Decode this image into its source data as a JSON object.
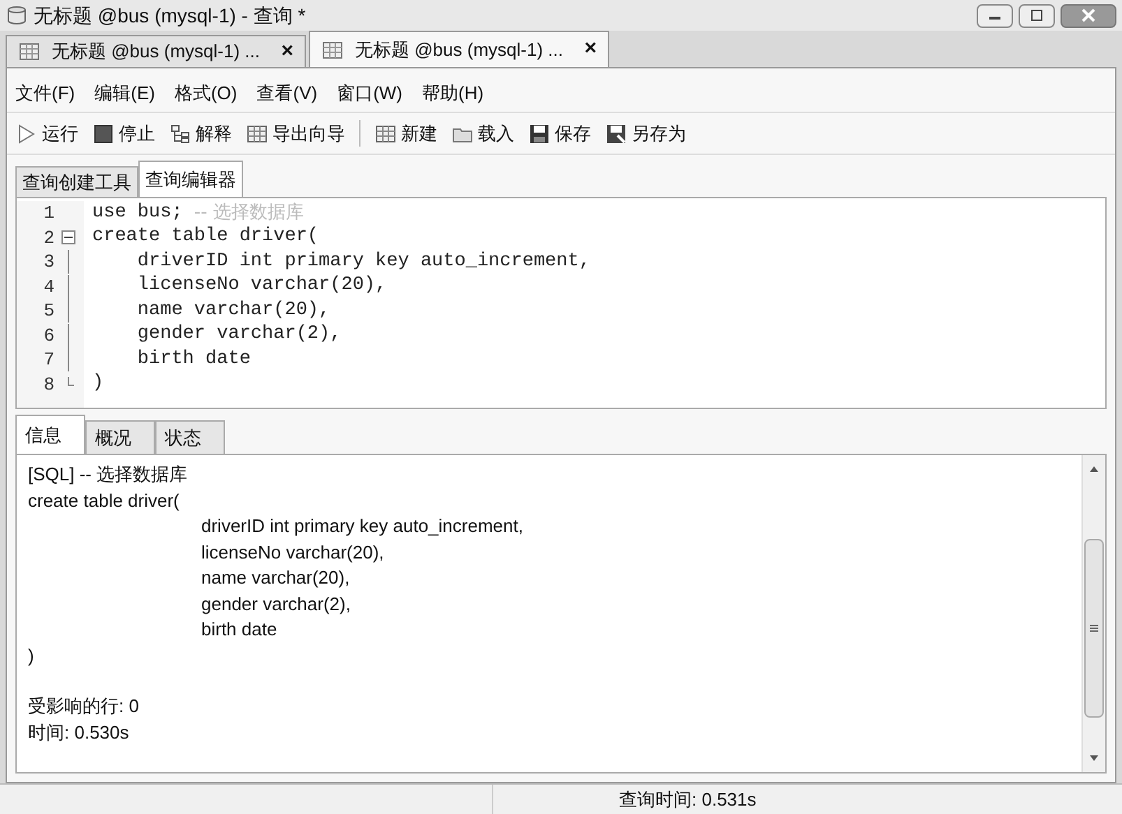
{
  "window": {
    "title": "无标题 @bus (mysql-1) - 查询 *"
  },
  "doc_tabs": [
    {
      "label": "无标题 @bus (mysql-1) ...",
      "close": "×",
      "selected": false
    },
    {
      "label": "无标题 @bus (mysql-1) ...",
      "close": "×",
      "selected": true
    }
  ],
  "menu": [
    "文件(F)",
    "编辑(E)",
    "格式(O)",
    "查看(V)",
    "窗口(W)",
    "帮助(H)"
  ],
  "toolbar": [
    [
      {
        "label": "运行",
        "kind": "run"
      },
      {
        "label": "停止",
        "kind": "stop"
      },
      {
        "label": "解释",
        "kind": "explain"
      },
      {
        "label": "导出向导",
        "kind": "export"
      }
    ],
    [
      {
        "label": "新建",
        "kind": "new"
      },
      {
        "label": "载入",
        "kind": "load"
      },
      {
        "label": "保存",
        "kind": "save"
      },
      {
        "label": "另存为",
        "kind": "saveas"
      }
    ]
  ],
  "editor_tabs": [
    {
      "label": "查询创建工具",
      "selected": false
    },
    {
      "label": "查询编辑器",
      "selected": true
    }
  ],
  "code_lines": [
    {
      "number": "1",
      "code": "use bus; ",
      "comment": "-- 选择数据库"
    },
    {
      "number": "2",
      "code": "create table driver(",
      "kind": "fold_start"
    },
    {
      "number": "3",
      "code": "    driverID int primary key auto_increment,"
    },
    {
      "number": "4",
      "code": "    licenseNo varchar(20),"
    },
    {
      "number": "5",
      "code": "    name varchar(20),"
    },
    {
      "number": "6",
      "code": "    gender varchar(2),"
    },
    {
      "number": "7",
      "code": "    birth date"
    },
    {
      "number": "8",
      "code": ")",
      "kind": "fold_end"
    }
  ],
  "result_tabs": [
    {
      "label": "信息",
      "selected": true
    },
    {
      "label": "概况",
      "selected": false
    },
    {
      "label": "状态",
      "selected": false
    }
  ],
  "message_lines": [
    {
      "text": "[SQL]  -- 选择数据库",
      "kind": "plain"
    },
    {
      "text": "create table driver(",
      "kind": "plain"
    },
    {
      "text": "driverID int primary key auto_increment,",
      "kind": "indent"
    },
    {
      "text": "licenseNo varchar(20),",
      "kind": "indent"
    },
    {
      "text": "name varchar(20),",
      "kind": "indent"
    },
    {
      "text": "gender varchar(2),",
      "kind": "indent"
    },
    {
      "text": "birth date",
      "kind": "indent"
    },
    {
      "text": ")",
      "kind": "plain"
    },
    {
      "text": "受影响的行: 0",
      "kind": "gap"
    },
    {
      "text": "时间: 0.530s",
      "kind": "plain"
    }
  ],
  "status_bar": {
    "query_time": "查询时间: 0.531s"
  }
}
